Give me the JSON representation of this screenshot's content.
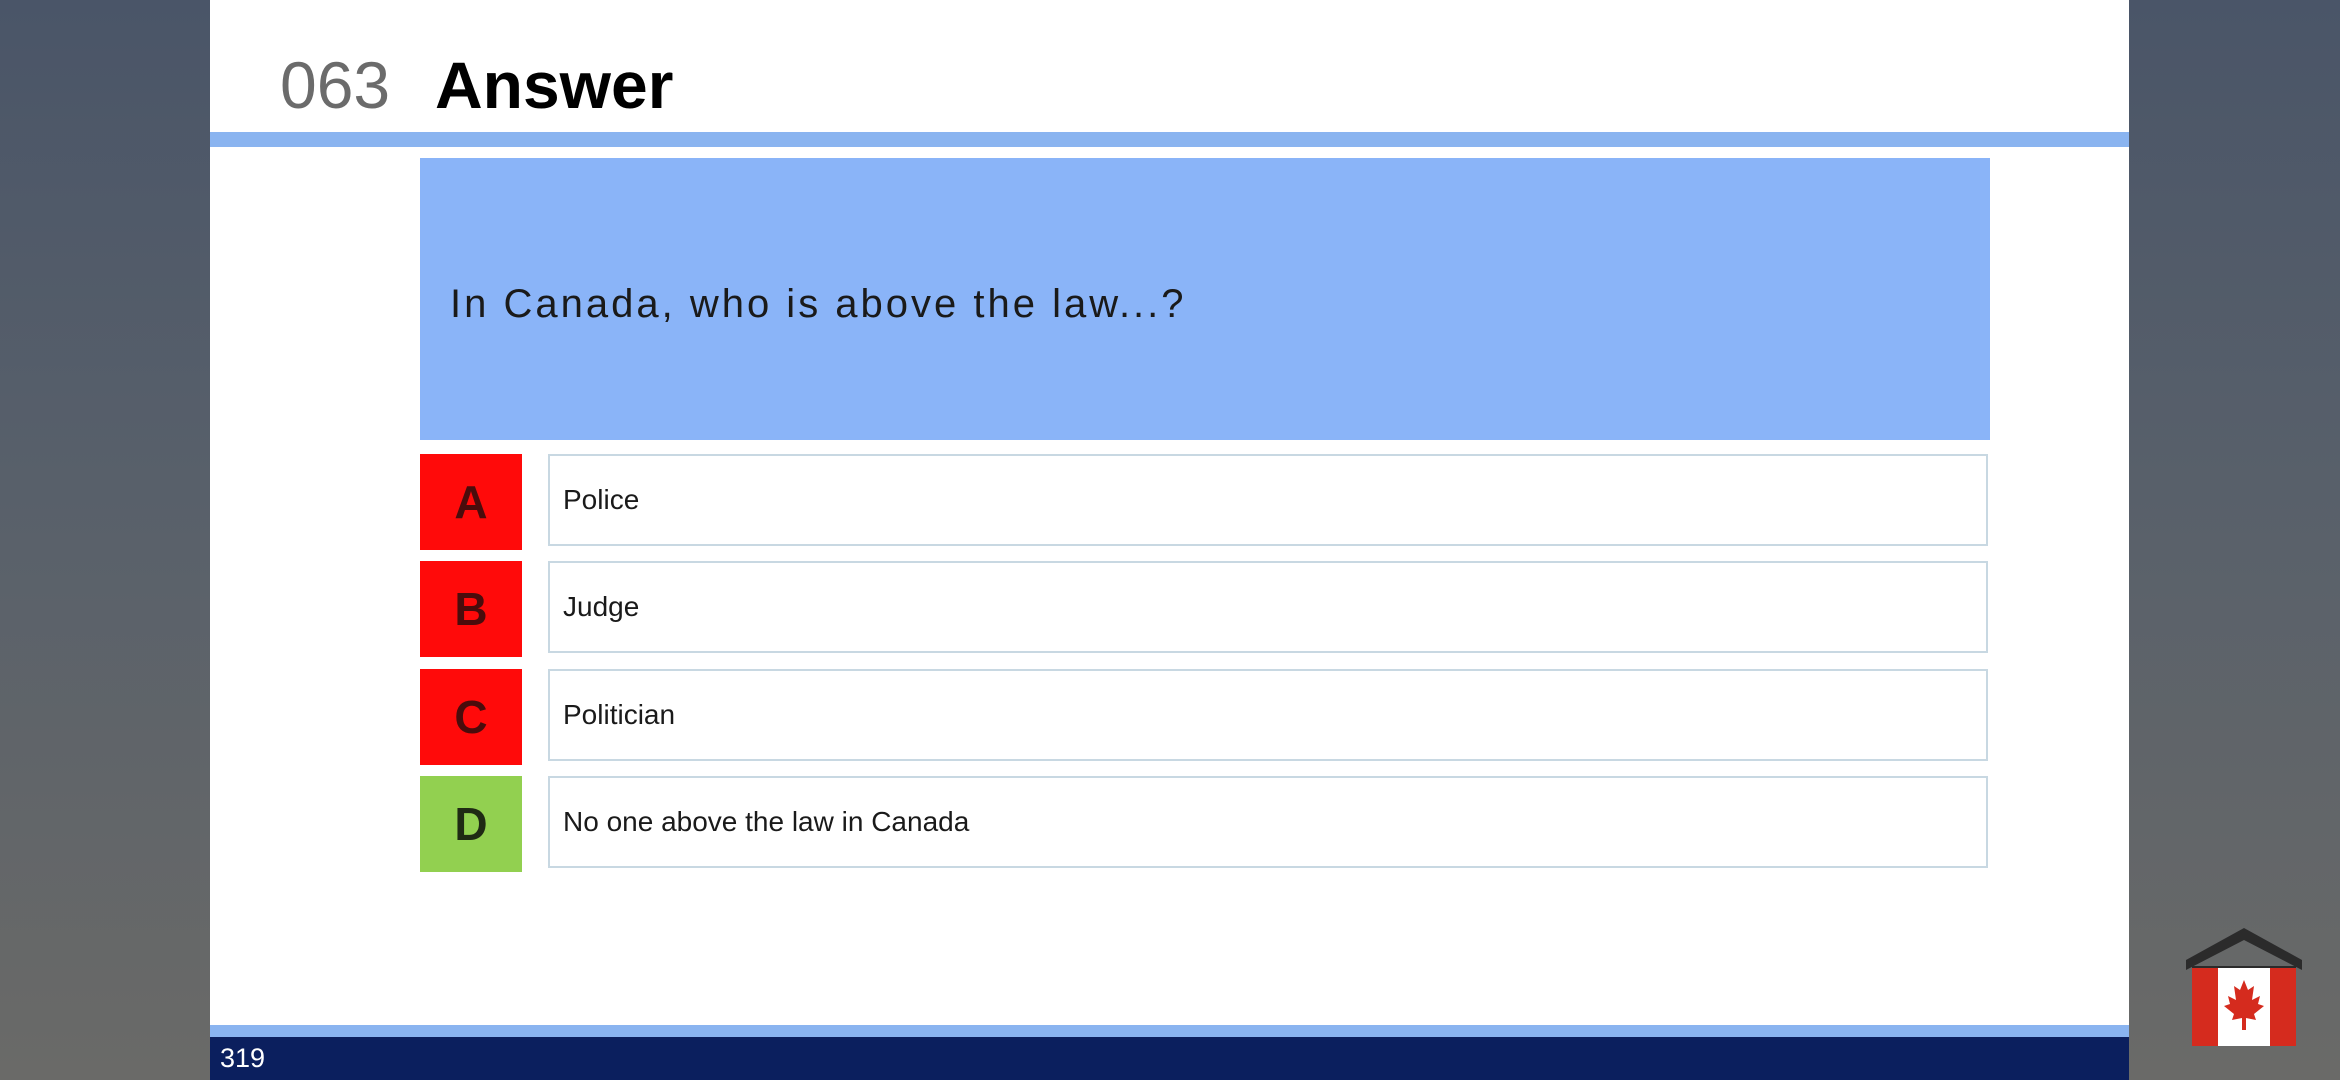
{
  "header": {
    "number": "063",
    "title": "Answer"
  },
  "question": {
    "text": "In Canada, who is above the law...?"
  },
  "options": [
    {
      "letter": "A",
      "text": "Police",
      "correct": false
    },
    {
      "letter": "B",
      "text": "Judge",
      "correct": false
    },
    {
      "letter": "C",
      "text": "Politician",
      "correct": false
    },
    {
      "letter": "D",
      "text": "No one above the law in Canada",
      "correct": true
    }
  ],
  "footer": {
    "page_number": "319"
  },
  "logo": {
    "icon": "house-canada-flag-icon"
  },
  "colors": {
    "wrong": "#ff0a0a",
    "correct": "#92d050",
    "question_bg": "#8ab4f8",
    "footer_band": "#0b1f5e",
    "rule": "#8ab4f0"
  }
}
